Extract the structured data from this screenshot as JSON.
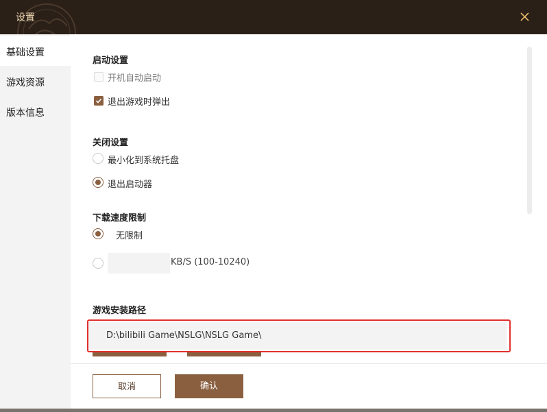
{
  "window": {
    "title": "设置",
    "close_icon": "close-icon",
    "accent_color": "#8a5f40",
    "titlebar_color": "#2b2018"
  },
  "sidebar": {
    "items": [
      {
        "label": "基础设置",
        "active": true
      },
      {
        "label": "游戏资源",
        "active": false
      },
      {
        "label": "版本信息",
        "active": false
      }
    ]
  },
  "startup": {
    "title": "启动设置",
    "auto_start": {
      "label": "开机自动启动",
      "checked": false
    },
    "popup_on_exit": {
      "label": "退出游戏时弹出",
      "checked": true
    }
  },
  "close_settings": {
    "title": "关闭设置",
    "minimize_tray": {
      "label": "最小化到系统托盘",
      "selected": false
    },
    "exit_launcher": {
      "label": "退出启动器",
      "selected": true
    }
  },
  "download_limit": {
    "title": "下载速度限制",
    "unlimited": {
      "label": "无限制",
      "selected": true
    },
    "custom": {
      "value": "",
      "unit": "KB/S (100-10240)",
      "selected": false
    }
  },
  "install_path": {
    "title": "游戏安装路径",
    "value": "D:\\bilibili Game\\NSLG\\NSLG Game\\",
    "highlight_color": "#e0302c"
  },
  "footer": {
    "cancel_label": "取消",
    "confirm_label": "确认"
  }
}
